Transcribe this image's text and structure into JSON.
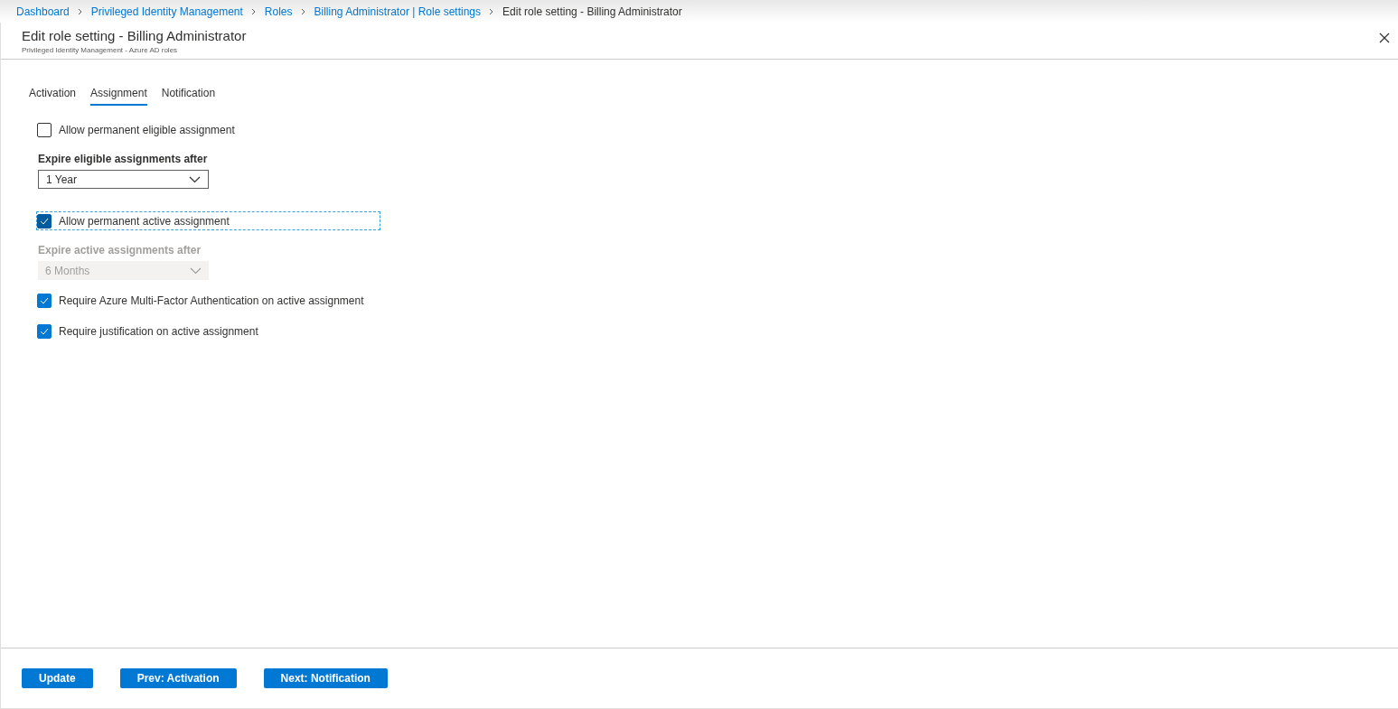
{
  "breadcrumb": [
    {
      "label": "Dashboard",
      "link": true
    },
    {
      "label": "Privileged Identity Management",
      "link": true
    },
    {
      "label": "Roles",
      "link": true
    },
    {
      "label": "Billing Administrator | Role settings",
      "link": true
    },
    {
      "label": "Edit role setting - Billing Administrator",
      "link": false
    }
  ],
  "panel": {
    "title": "Edit role setting - Billing Administrator",
    "subtitle": "Privileged Identity Management - Azure AD roles"
  },
  "tabs": [
    {
      "label": "Activation",
      "selected": false
    },
    {
      "label": "Assignment",
      "selected": true
    },
    {
      "label": "Notification",
      "selected": false
    }
  ],
  "form": [
    {
      "kind": "checkbox",
      "label": "Allow permanent eligible assignment",
      "checked": false,
      "focused": false
    },
    {
      "kind": "dropdown",
      "label": "Expire eligible assignments after",
      "value": "1 Year",
      "disabled": false
    },
    {
      "kind": "checkbox",
      "label": "Allow permanent active assignment",
      "checked": true,
      "focused": true
    },
    {
      "kind": "dropdown",
      "label": "Expire active assignments after",
      "value": "6 Months",
      "disabled": true
    },
    {
      "kind": "checkbox",
      "label": "Require Azure Multi-Factor Authentication on active assignment",
      "checked": true,
      "focused": false
    },
    {
      "kind": "checkbox",
      "label": "Require justification on active assignment",
      "checked": true,
      "focused": false
    }
  ],
  "buttons": [
    "Update",
    "Prev: Activation",
    "Next: Notification"
  ]
}
